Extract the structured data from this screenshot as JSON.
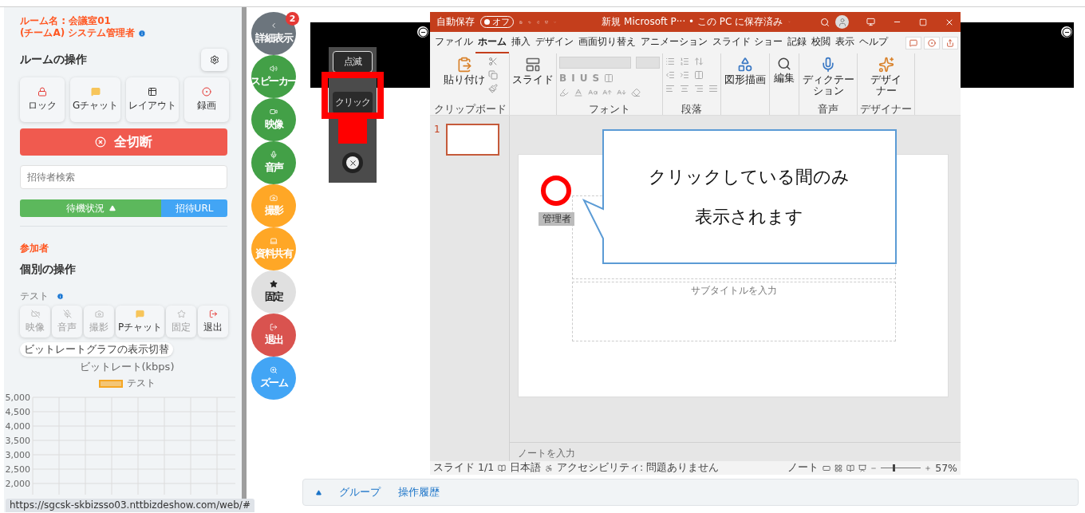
{
  "sidebar": {
    "room_name": "ルーム名 : 会議室01",
    "user_role": "(チームA) システム管理者",
    "room_ops_title": "ルームの操作",
    "room_ops": [
      {
        "label": "ロック"
      },
      {
        "label": "Gチャット"
      },
      {
        "label": "レイアウト"
      },
      {
        "label": "録画"
      }
    ],
    "disconnect_all": "全切断",
    "invitee_search": {
      "placeholder": "招待者検索"
    },
    "waiting_status": {
      "label": "待機状況",
      "expanded": true
    },
    "invite_url": "招待URL",
    "participants_label": "参加者",
    "individual_ops_title": "個別の操作",
    "participant_name": "テスト",
    "individual_ops": [
      {
        "label": "映像",
        "disabled": true
      },
      {
        "label": "音声",
        "disabled": true
      },
      {
        "label": "撮影",
        "disabled": true
      },
      {
        "label": "Pチャット",
        "disabled": false
      },
      {
        "label": "固定",
        "disabled": true
      },
      {
        "label": "退出",
        "disabled": false
      }
    ],
    "bitrate_toggle": "ビットレートグラフの表示切替",
    "chart_data": {
      "type": "line",
      "title": "ビットレート(kbps)",
      "ylim": [
        2000,
        5000
      ],
      "grid": true,
      "yticks": [
        {
          "value": 2000,
          "label": "2,000"
        },
        {
          "value": 2500,
          "label": "2,500"
        },
        {
          "value": 3000,
          "label": "3,000"
        },
        {
          "value": 3500,
          "label": "3,500"
        },
        {
          "value": 4000,
          "label": "4,000"
        },
        {
          "value": 4500,
          "label": "4,500"
        },
        {
          "value": 5000,
          "label": "5,000"
        }
      ],
      "series": [
        {
          "name": "テスト",
          "color": "#f5a623"
        }
      ]
    }
  },
  "rail": [
    {
      "label": "詳細表示",
      "color": "#6c757d",
      "badge": "2"
    },
    {
      "label": "スピーカー",
      "color": "#43a047"
    },
    {
      "label": "映像",
      "color": "#43a047"
    },
    {
      "label": "音声",
      "color": "#43a047"
    },
    {
      "label": "撮影",
      "color": "#ffa726"
    },
    {
      "label": "資料共有",
      "color": "#ffa726"
    },
    {
      "label": "固定",
      "color": "#e0e0e0"
    },
    {
      "label": "退出",
      "color": "#d9534f"
    },
    {
      "label": "ズーム",
      "color": "#42a5f5"
    }
  ],
  "pointer_popup": {
    "modes": [
      {
        "label": "点滅",
        "highlighted": false
      },
      {
        "label": "クリック",
        "highlighted": true
      }
    ]
  },
  "powerpoint": {
    "autosave": {
      "label": "自動保存",
      "state": "オフ",
      "on": false
    },
    "doc_title": "新規 Microsoft P··· • この PC に保存済み",
    "tabs": [
      {
        "label": "ファイル",
        "selected": false
      },
      {
        "label": "ホーム",
        "selected": true
      },
      {
        "label": "挿入",
        "selected": false
      },
      {
        "label": "デザイン",
        "selected": false
      },
      {
        "label": "画面切り替え",
        "selected": false
      },
      {
        "label": "アニメーション",
        "selected": false
      },
      {
        "label": "スライド ショー",
        "selected": false
      },
      {
        "label": "記録",
        "selected": false
      },
      {
        "label": "校閲",
        "selected": false
      },
      {
        "label": "表示",
        "selected": false
      },
      {
        "label": "ヘルプ",
        "selected": false
      }
    ],
    "ribbon": {
      "paste": "貼り付け",
      "clipboard_label": "クリップボード",
      "new_slide": "スライド",
      "font_label": "フォント",
      "style_buttons": [
        "B",
        "I",
        "U",
        "S"
      ],
      "paragraph_label": "段落",
      "drawing": "図形描画",
      "editing": "編集",
      "dictation": "ディクテーション",
      "voice_label": "音声",
      "designer": "デザイナー",
      "designer_label": "デザイナー"
    },
    "thumbnail_number": "1",
    "slide": {
      "subtitle_placeholder": "サブタイトルを入力",
      "pointer_label": "管理者",
      "callout_lines": [
        "クリックしている間のみ",
        "表示されます"
      ]
    },
    "notes_placeholder": "ノートを入力",
    "status": {
      "slide": "スライド 1/1",
      "language": "日本語",
      "accessibility": "アクセシビリティ: 問題ありません",
      "notes": "ノート",
      "zoom": "57%",
      "zoom_level": {
        "level": 0.3
      }
    }
  },
  "bottom_tabs": [
    "グループ",
    "操作履歴"
  ],
  "status_url": "https://sgcsk-skbizsso03.nttbizdeshow.com/web/#"
}
